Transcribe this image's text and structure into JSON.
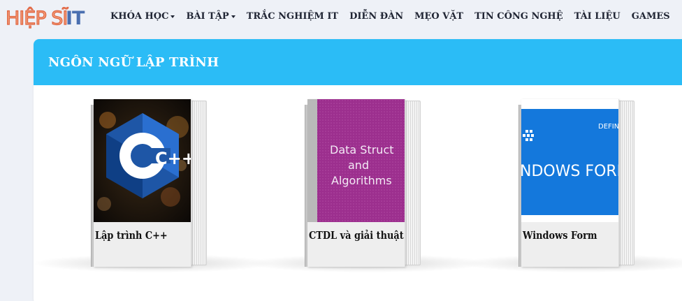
{
  "logo": {
    "text_part1": "HIỆP SĨ",
    "text_part2": "IT"
  },
  "nav": {
    "items": [
      {
        "label": "KHÓA HỌC",
        "has_dropdown": true
      },
      {
        "label": "BÀI TẬP",
        "has_dropdown": true
      },
      {
        "label": "TRẮC NGHIỆM IT",
        "has_dropdown": false
      },
      {
        "label": "DIỄN ĐÀN",
        "has_dropdown": false
      },
      {
        "label": "MẸO VẶT",
        "has_dropdown": false
      },
      {
        "label": "TIN CÔNG NGHỆ",
        "has_dropdown": false
      },
      {
        "label": "TÀI LIỆU",
        "has_dropdown": false
      },
      {
        "label": "GAMES",
        "has_dropdown": false
      }
    ]
  },
  "section": {
    "title": "NGÔN NGỮ LẬP TRÌNH",
    "header_color": "#2bbcf6"
  },
  "books": [
    {
      "title": "Lập trình C++",
      "cover_text": "C++"
    },
    {
      "title": "CTDL và giải thuật",
      "cover_lines": [
        "Data Struct",
        "and",
        "Algorithms"
      ]
    },
    {
      "title": "Windows Form",
      "cover_text": "NDOWS FORM",
      "cover_corner": "DEFIN"
    }
  ]
}
